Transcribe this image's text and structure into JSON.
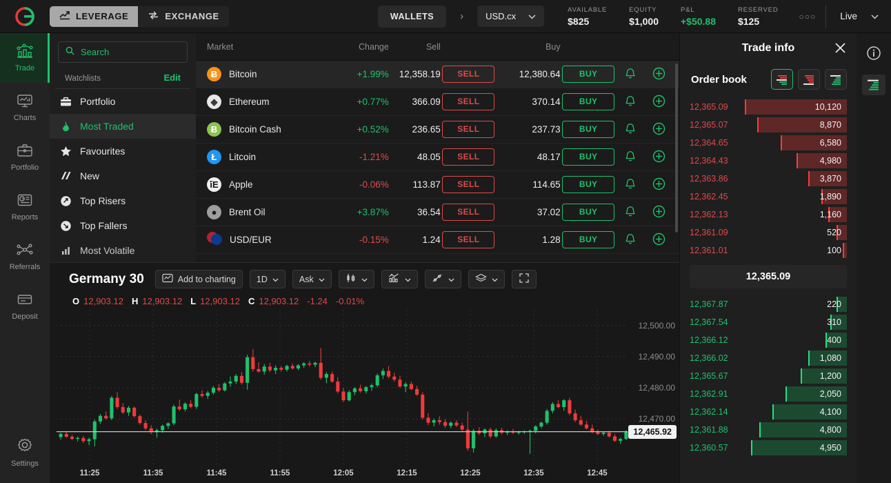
{
  "topbar": {
    "logo": "circle-c-logo",
    "modes": [
      {
        "label": "LEVERAGE",
        "icon": "trend-up-icon",
        "active": true
      },
      {
        "label": "EXCHANGE",
        "icon": "swap-icon",
        "active": false
      }
    ],
    "wallets_label": "WALLETS",
    "currency": "USD.cx",
    "stats": [
      {
        "label": "AVAILABLE",
        "value": "$825",
        "accent": false
      },
      {
        "label": "EQUITY",
        "value": "$1,000",
        "accent": false
      },
      {
        "label": "P&L",
        "value": "+$50.88",
        "accent": true
      },
      {
        "label": "RESERVED",
        "value": "$125",
        "accent": false
      }
    ],
    "more_label": "○○○",
    "live_label": "Live"
  },
  "rail": {
    "items": [
      {
        "label": "Trade",
        "icon": "trade-chart-icon",
        "active": true
      },
      {
        "label": "Charts",
        "icon": "monitor-chart-icon",
        "active": false
      },
      {
        "label": "Portfolio",
        "icon": "briefcase-icon",
        "active": false
      },
      {
        "label": "Reports",
        "icon": "report-doc-icon",
        "active": false
      },
      {
        "label": "Referrals",
        "icon": "network-nodes-icon",
        "active": false
      },
      {
        "label": "Deposit",
        "icon": "card-icon",
        "active": false
      }
    ],
    "settings": {
      "label": "Settings",
      "icon": "gear-icon"
    }
  },
  "sidebar": {
    "search_placeholder": "Search",
    "search_value": "",
    "watchlists_label": "Watchlists",
    "edit_label": "Edit",
    "items": [
      {
        "label": "Portfolio",
        "icon": "briefcase-icon",
        "active": false
      },
      {
        "label": "Most Traded",
        "icon": "flame-icon",
        "active": true
      },
      {
        "label": "Favourites",
        "icon": "star-icon",
        "active": false
      },
      {
        "label": "New",
        "icon": "new-slash-icon",
        "active": false
      },
      {
        "label": "Top Risers",
        "icon": "arrow-up-circle-icon",
        "active": false
      },
      {
        "label": "Top Fallers",
        "icon": "arrow-down-circle-icon",
        "active": false
      },
      {
        "label": "Most Volatile",
        "icon": "bars-icon",
        "active": false
      }
    ]
  },
  "market_table": {
    "columns": [
      "Market",
      "Change",
      "Sell",
      "Buy"
    ],
    "sell_button_label": "SELL",
    "buy_button_label": "BUY",
    "alert_icon": "bell-icon",
    "add_icon": "plus-circle-icon",
    "rows": [
      {
        "name": "Bitcoin",
        "symbol": "Ƀ",
        "coin_color": "#f7931a",
        "coin_text": "#ffffff",
        "change": "+1.99%",
        "dir": "up",
        "sell": "12,358.19",
        "buy": "12,380.64",
        "highlighted": true
      },
      {
        "name": "Ethereum",
        "symbol": "◆",
        "coin_color": "#e8e8e8",
        "coin_text": "#3c3c3c",
        "change": "+0.77%",
        "dir": "up",
        "sell": "366.09",
        "buy": "370.14",
        "highlighted": false
      },
      {
        "name": "Bitcoin Cash",
        "symbol": "Ƀ",
        "coin_color": "#8dc351",
        "coin_text": "#ffffff",
        "change": "+0.52%",
        "dir": "up",
        "sell": "236.65",
        "buy": "237.73",
        "highlighted": false
      },
      {
        "name": "Litcoin",
        "symbol": "Ł",
        "coin_color": "#2196f3",
        "coin_text": "#ffffff",
        "change": "-1.21%",
        "dir": "down",
        "sell": "48.05",
        "buy": "48.17",
        "highlighted": false
      },
      {
        "name": "Apple",
        "symbol": "ἴE",
        "coin_color": "#f0f0f0",
        "coin_text": "#111111",
        "change": "-0.06%",
        "dir": "down",
        "sell": "113.87",
        "buy": "114.65",
        "highlighted": false
      },
      {
        "name": "Brent Oil",
        "symbol": "●",
        "coin_color": "#9e9e9e",
        "coin_text": "#1a1a1a",
        "change": "+3.87%",
        "dir": "up",
        "sell": "36.54",
        "buy": "37.02",
        "highlighted": false
      },
      {
        "name": "USD/EUR",
        "symbol": "⬤",
        "coin_color": "#3f51b5",
        "coin_text": "#ffffff",
        "change": "-0.15%",
        "dir": "down",
        "sell": "1.24",
        "buy": "1.28",
        "highlighted": false
      }
    ]
  },
  "chart_panel": {
    "title": "Germany 30",
    "add_to_charting_label": "Add to charting",
    "add_to_charting_icon": "chart-box-icon",
    "tools": [
      {
        "label": "1D",
        "icon": "",
        "caret": true
      },
      {
        "label": "Ask",
        "icon": "",
        "caret": true
      },
      {
        "label": "",
        "icon": "candles-icon",
        "caret": true
      },
      {
        "label": "",
        "icon": "indicator-icon",
        "caret": true
      },
      {
        "label": "",
        "icon": "draw-line-icon",
        "caret": true
      },
      {
        "label": "",
        "icon": "layers-icon",
        "caret": true
      },
      {
        "label": "",
        "icon": "fullscreen-icon",
        "caret": false
      }
    ],
    "ohlc": {
      "o_label": "O",
      "o": "12,903.12",
      "h_label": "H",
      "h": "12,903.12",
      "l_label": "L",
      "l": "12,903.12",
      "c_label": "C",
      "c": "12,903.12",
      "abs_change": "-1.24",
      "pct_change": "-0.01%"
    }
  },
  "chart_data": {
    "type": "candlestick",
    "title": "Germany 30",
    "interval": "1D",
    "price_source": "Ask",
    "ylabel": "",
    "xlabel": "",
    "ylim": [
      12455,
      12505
    ],
    "y_ticks": [
      "12,500.00",
      "12,490.00",
      "12,480.00",
      "12,470.00"
    ],
    "y_tick_values": [
      12500,
      12490,
      12480,
      12470
    ],
    "last_price": "12,465.92",
    "last_price_value": 12465.92,
    "x_ticks": [
      "11:25",
      "11:35",
      "11:45",
      "11:55",
      "12:05",
      "12:15",
      "12:25",
      "12:35",
      "12:45"
    ],
    "grid": true,
    "up_color": "#1fc16b",
    "down_color": "#ef3b3b",
    "ohlc": [
      [
        12464.2,
        12465.6,
        12463.4,
        12465.2
      ],
      [
        12465.2,
        12465.8,
        12463.9,
        12464.3
      ],
      [
        12464.3,
        12465.0,
        12463.2,
        12463.6
      ],
      [
        12463.6,
        12464.4,
        12462.8,
        12463.9
      ],
      [
        12463.9,
        12464.6,
        12462.3,
        12462.9
      ],
      [
        12462.9,
        12464.0,
        12461.6,
        12463.5
      ],
      [
        12463.5,
        12469.8,
        12461.2,
        12469.2
      ],
      [
        12469.2,
        12471.6,
        12468.4,
        12471.0
      ],
      [
        12471.0,
        12472.4,
        12469.8,
        12470.2
      ],
      [
        12470.2,
        12477.4,
        12469.6,
        12476.8
      ],
      [
        12476.8,
        12478.6,
        12473.2,
        12473.8
      ],
      [
        12473.8,
        12475.0,
        12471.6,
        12472.1
      ],
      [
        12472.1,
        12474.2,
        12471.0,
        12473.6
      ],
      [
        12473.6,
        12474.0,
        12470.4,
        12470.9
      ],
      [
        12470.9,
        12471.4,
        12468.2,
        12468.7
      ],
      [
        12468.7,
        12469.6,
        12466.4,
        12467.0
      ],
      [
        12467.0,
        12468.0,
        12465.1,
        12465.8
      ],
      [
        12465.8,
        12466.9,
        12464.0,
        12466.4
      ],
      [
        12466.4,
        12468.2,
        12465.6,
        12467.8
      ],
      [
        12467.8,
        12469.0,
        12466.8,
        12468.6
      ],
      [
        12468.6,
        12474.6,
        12468.0,
        12474.0
      ],
      [
        12474.0,
        12476.2,
        12472.6,
        12473.1
      ],
      [
        12473.1,
        12475.4,
        12472.4,
        12474.9
      ],
      [
        12474.9,
        12476.0,
        12473.4,
        12473.9
      ],
      [
        12473.9,
        12478.4,
        12473.2,
        12478.0
      ],
      [
        12478.0,
        12479.2,
        12476.8,
        12477.4
      ],
      [
        12477.4,
        12479.0,
        12476.4,
        12478.4
      ],
      [
        12478.4,
        12480.6,
        12477.8,
        12480.0
      ],
      [
        12480.0,
        12481.2,
        12478.6,
        12479.2
      ],
      [
        12479.2,
        12481.8,
        12478.8,
        12481.4
      ],
      [
        12481.4,
        12483.6,
        12480.4,
        12482.0
      ],
      [
        12482.0,
        12484.4,
        12481.2,
        12483.8
      ],
      [
        12483.8,
        12485.0,
        12481.0,
        12481.6
      ],
      [
        12481.6,
        12490.6,
        12479.4,
        12489.8
      ],
      [
        12489.8,
        12492.4,
        12485.2,
        12486.0
      ],
      [
        12486.0,
        12488.2,
        12484.8,
        12485.2
      ],
      [
        12485.2,
        12487.6,
        12484.2,
        12486.8
      ],
      [
        12486.8,
        12488.0,
        12485.0,
        12485.6
      ],
      [
        12485.6,
        12487.2,
        12484.4,
        12486.4
      ],
      [
        12486.4,
        12487.0,
        12485.2,
        12485.8
      ],
      [
        12485.8,
        12487.4,
        12485.2,
        12487.0
      ],
      [
        12487.0,
        12487.8,
        12485.8,
        12486.2
      ],
      [
        12486.2,
        12487.6,
        12485.6,
        12487.2
      ],
      [
        12487.2,
        12488.2,
        12486.4,
        12487.8
      ],
      [
        12487.8,
        12488.6,
        12486.8,
        12487.4
      ],
      [
        12487.4,
        12488.4,
        12486.6,
        12488.0
      ],
      [
        12488.0,
        12492.8,
        12482.6,
        12483.2
      ],
      [
        12483.2,
        12485.0,
        12481.4,
        12484.4
      ],
      [
        12484.4,
        12485.2,
        12481.6,
        12482.0
      ],
      [
        12482.0,
        12483.4,
        12478.2,
        12478.8
      ],
      [
        12478.8,
        12480.0,
        12475.4,
        12476.0
      ],
      [
        12476.0,
        12479.2,
        12475.6,
        12478.6
      ],
      [
        12478.6,
        12480.2,
        12477.6,
        12479.8
      ],
      [
        12479.8,
        12481.0,
        12478.4,
        12478.9
      ],
      [
        12478.9,
        12480.6,
        12478.2,
        12480.2
      ],
      [
        12480.2,
        12481.4,
        12479.0,
        12480.8
      ],
      [
        12480.8,
        12484.6,
        12480.2,
        12484.0
      ],
      [
        12484.0,
        12486.2,
        12482.8,
        12485.4
      ],
      [
        12485.4,
        12487.0,
        12483.0,
        12483.6
      ],
      [
        12483.6,
        12484.8,
        12482.0,
        12482.6
      ],
      [
        12482.6,
        12483.8,
        12480.0,
        12480.4
      ],
      [
        12480.4,
        12481.8,
        12478.6,
        12481.2
      ],
      [
        12481.2,
        12482.0,
        12479.2,
        12479.6
      ],
      [
        12479.6,
        12480.6,
        12477.4,
        12477.8
      ],
      [
        12477.8,
        12478.6,
        12469.8,
        12470.4
      ],
      [
        12470.4,
        12471.8,
        12468.0,
        12468.8
      ],
      [
        12468.8,
        12470.2,
        12467.6,
        12469.6
      ],
      [
        12469.6,
        12470.8,
        12468.2,
        12469.0
      ],
      [
        12469.0,
        12470.0,
        12467.2,
        12467.8
      ],
      [
        12467.8,
        12469.2,
        12467.0,
        12468.8
      ],
      [
        12468.8,
        12469.6,
        12467.4,
        12467.9
      ],
      [
        12467.9,
        12468.8,
        12466.0,
        12466.6
      ],
      [
        12466.6,
        12472.4,
        12459.8,
        12460.6
      ],
      [
        12460.6,
        12466.8,
        12459.2,
        12466.2
      ],
      [
        12466.2,
        12467.4,
        12464.8,
        12465.4
      ],
      [
        12465.4,
        12467.0,
        12464.2,
        12466.6
      ],
      [
        12466.6,
        12467.2,
        12463.8,
        12464.4
      ],
      [
        12464.4,
        12467.0,
        12464.0,
        12466.4
      ],
      [
        12466.4,
        12467.2,
        12465.0,
        12465.6
      ],
      [
        12465.6,
        12466.4,
        12464.8,
        12466.0
      ],
      [
        12466.0,
        12466.8,
        12465.2,
        12465.6
      ],
      [
        12465.6,
        12466.2,
        12465.0,
        12465.8
      ],
      [
        12465.8,
        12466.4,
        12465.2,
        12466.0
      ],
      [
        12466.0,
        12466.6,
        12458.8,
        12466.2
      ],
      [
        12466.2,
        12468.0,
        12465.4,
        12467.6
      ],
      [
        12467.6,
        12469.2,
        12467.0,
        12468.8
      ],
      [
        12468.8,
        12473.2,
        12468.2,
        12472.6
      ],
      [
        12472.6,
        12475.4,
        12471.8,
        12474.8
      ],
      [
        12474.8,
        12476.0,
        12473.4,
        12473.8
      ],
      [
        12473.8,
        12476.4,
        12472.6,
        12476.0
      ],
      [
        12476.0,
        12476.8,
        12471.2,
        12471.8
      ],
      [
        12471.8,
        12473.0,
        12469.0,
        12469.6
      ],
      [
        12469.6,
        12471.0,
        12467.8,
        12468.2
      ],
      [
        12468.2,
        12469.4,
        12466.6,
        12467.0
      ],
      [
        12467.0,
        12468.2,
        12465.4,
        12465.8
      ],
      [
        12465.8,
        12466.6,
        12464.8,
        12465.2
      ],
      [
        12465.2,
        12466.0,
        12464.6,
        12465.6
      ],
      [
        12465.6,
        12466.2,
        12464.0,
        12464.4
      ],
      [
        12464.4,
        12465.2,
        12462.6,
        12463.0
      ],
      [
        12463.0,
        12464.0,
        12462.0,
        12463.6
      ],
      [
        12463.6,
        12466.4,
        12463.2,
        12465.9
      ]
    ]
  },
  "trade_info": {
    "title": "Trade info",
    "close_icon": "close-icon",
    "order_book_label": "Order book",
    "view_modes": [
      {
        "name": "both-sides-view",
        "selected": true
      },
      {
        "name": "sell-only-view",
        "selected": false
      },
      {
        "name": "buy-only-view",
        "selected": false
      }
    ],
    "mid_price": "12,365.09",
    "sell_side": [
      {
        "price": "12,365.09",
        "qty": "10,120",
        "pct": 100
      },
      {
        "price": "12,365.07",
        "qty": "8,870",
        "pct": 88
      },
      {
        "price": "12,364.65",
        "qty": "6,580",
        "pct": 65
      },
      {
        "price": "12,364.43",
        "qty": "4,980",
        "pct": 49
      },
      {
        "price": "12,363.86",
        "qty": "3,870",
        "pct": 38
      },
      {
        "price": "12,362.45",
        "qty": "1,890",
        "pct": 25
      },
      {
        "price": "12,362.13",
        "qty": "1,160",
        "pct": 18
      },
      {
        "price": "12,361.09",
        "qty": "520",
        "pct": 10
      },
      {
        "price": "12,361.01",
        "qty": "100",
        "pct": 4
      }
    ],
    "buy_side": [
      {
        "price": "12,367.87",
        "qty": "220",
        "pct": 10
      },
      {
        "price": "12,367.54",
        "qty": "310",
        "pct": 16
      },
      {
        "price": "12,366.12",
        "qty": "400",
        "pct": 21
      },
      {
        "price": "12,366.02",
        "qty": "1,080",
        "pct": 38
      },
      {
        "price": "12,365.67",
        "qty": "1,200",
        "pct": 45
      },
      {
        "price": "12,362.91",
        "qty": "2,050",
        "pct": 60
      },
      {
        "price": "12,362.14",
        "qty": "4,100",
        "pct": 73
      },
      {
        "price": "12,361.88",
        "qty": "4,800",
        "pct": 86
      },
      {
        "price": "12,360.57",
        "qty": "4,950",
        "pct": 94
      }
    ],
    "rail": [
      {
        "name": "info-icon",
        "selected": false
      },
      {
        "name": "order-book-icon",
        "selected": true
      }
    ]
  }
}
